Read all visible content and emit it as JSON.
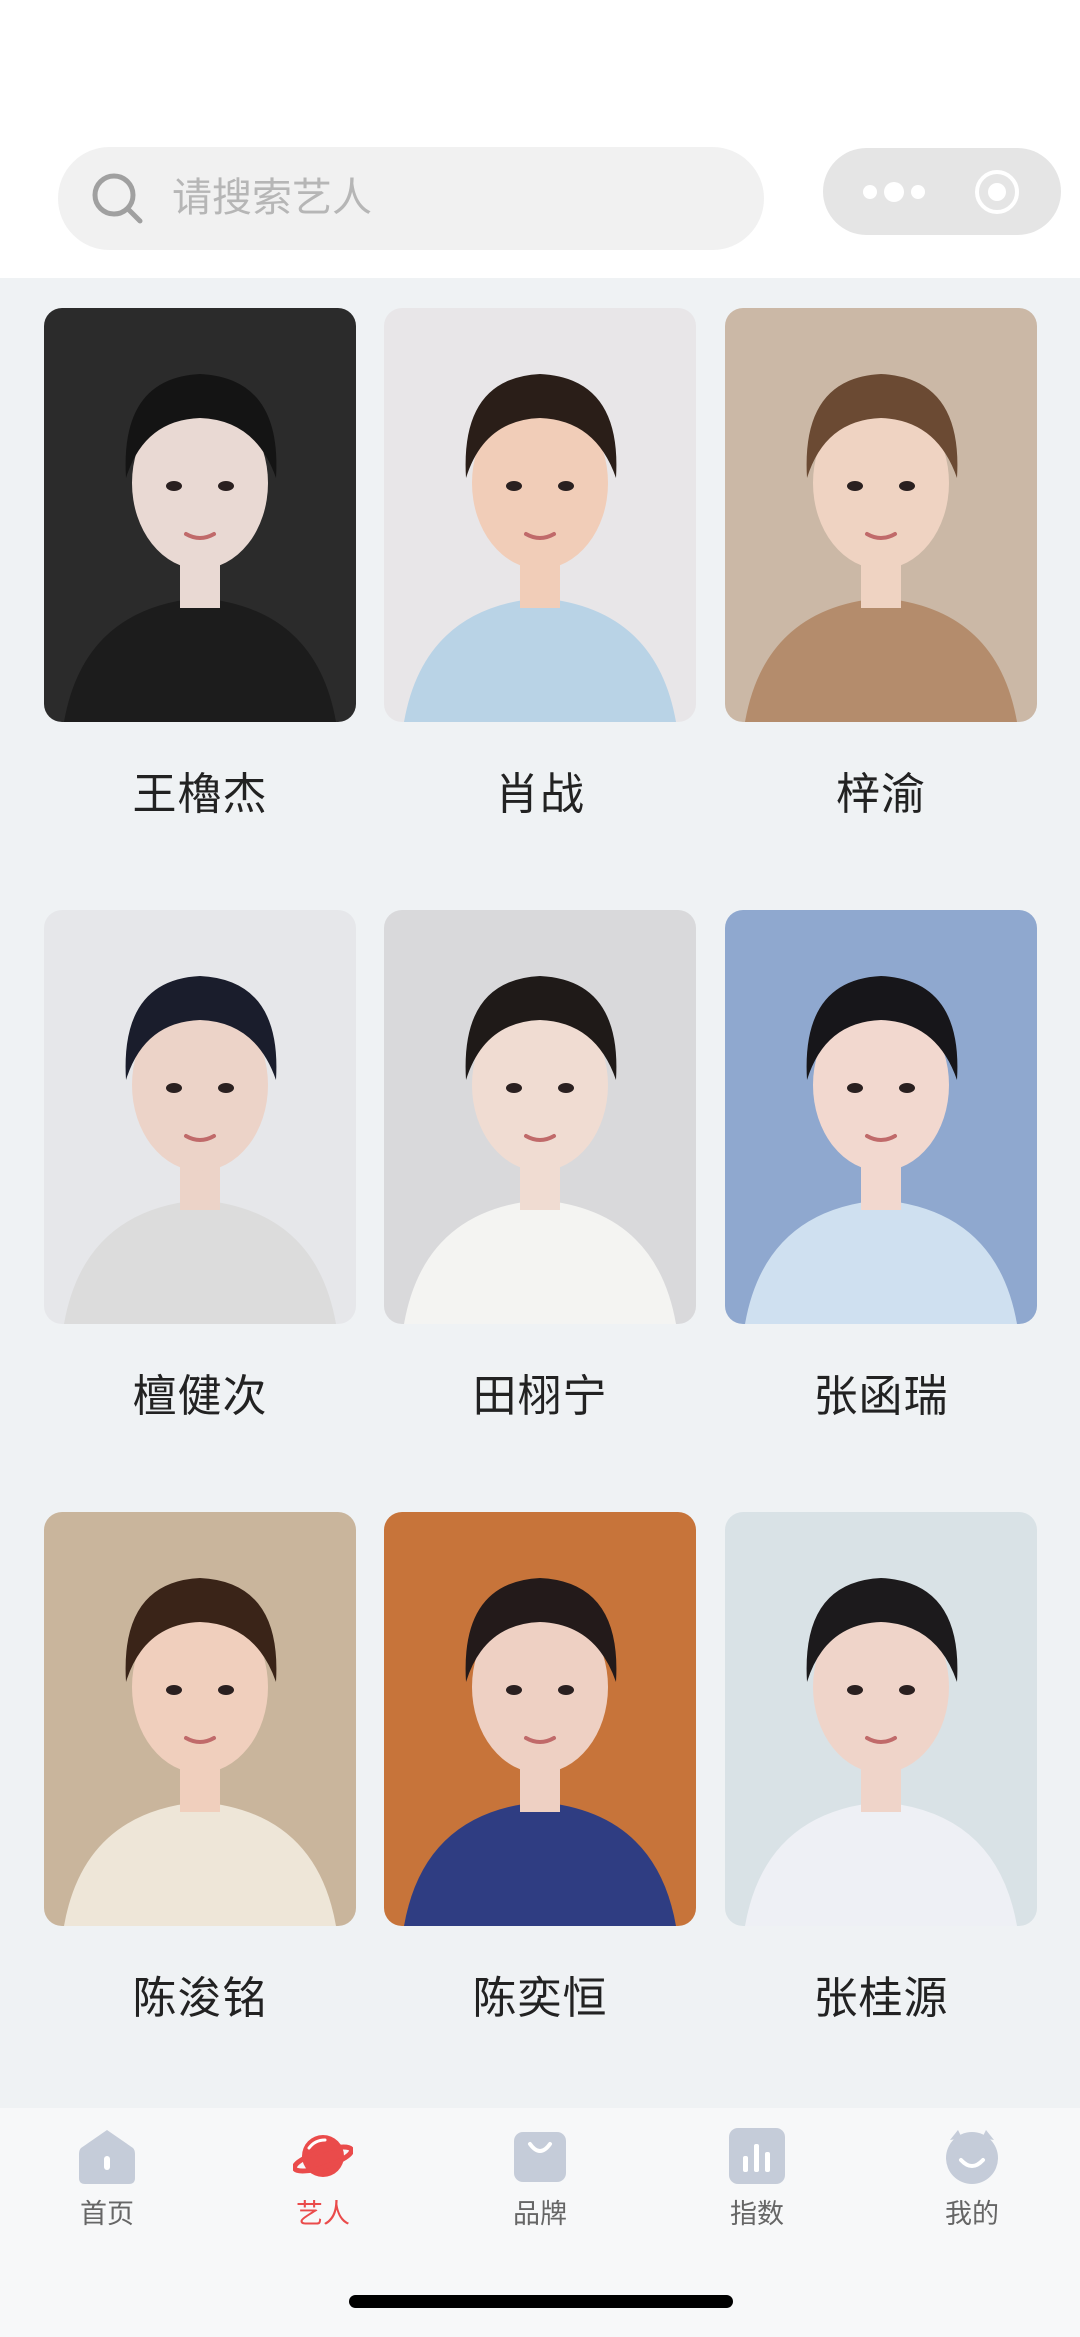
{
  "search": {
    "placeholder": "请搜索艺人"
  },
  "artists": [
    {
      "name": "王櫓杰",
      "photo_tone": "#2b2b2b",
      "skin": "#e9d9d3",
      "hair": "#141414",
      "cloth": "#1c1c1c"
    },
    {
      "name": "肖战",
      "photo_tone": "#e8e6e8",
      "skin": "#f1cdb8",
      "hair": "#2a1e18",
      "cloth": "#b9d3e6"
    },
    {
      "name": "梓渝",
      "photo_tone": "#cbb8a6",
      "skin": "#efd3c2",
      "hair": "#6b4a33",
      "cloth": "#b48c6c"
    },
    {
      "name": "檀健次",
      "photo_tone": "#e6e7ea",
      "skin": "#ecd3c8",
      "hair": "#1a1d2c",
      "cloth": "#dcdcdc"
    },
    {
      "name": "田栩宁",
      "photo_tone": "#d9d9db",
      "skin": "#f0dcd2",
      "hair": "#1f1a18",
      "cloth": "#f4f4f2"
    },
    {
      "name": "张函瑞",
      "photo_tone": "#8fa8cf",
      "skin": "#f2d8cf",
      "hair": "#17161a",
      "cloth": "#cfe0f0"
    },
    {
      "name": "陈浚铭",
      "photo_tone": "#c9b59c",
      "skin": "#f0cfbd",
      "hair": "#3a2418",
      "cloth": "#eee6d8"
    },
    {
      "name": "陈奕恒",
      "photo_tone": "#c7743a",
      "skin": "#eed0c3",
      "hair": "#231a1a",
      "cloth": "#2f3d82"
    },
    {
      "name": "张桂源",
      "photo_tone": "#d9e2e6",
      "skin": "#efd4c9",
      "hair": "#1c1a1c",
      "cloth": "#eef0f5"
    }
  ],
  "tabs": [
    {
      "label": "首页",
      "icon": "home-icon",
      "active": false
    },
    {
      "label": "艺人",
      "icon": "planet-icon",
      "active": true
    },
    {
      "label": "品牌",
      "icon": "bag-icon",
      "active": false
    },
    {
      "label": "指数",
      "icon": "bar-chart-icon",
      "active": false
    },
    {
      "label": "我的",
      "icon": "profile-icon",
      "active": false
    }
  ],
  "colors": {
    "accent": "#ea4b4b",
    "tab_icon_inactive": "#c5ccd9",
    "background": "#eff2f4"
  }
}
